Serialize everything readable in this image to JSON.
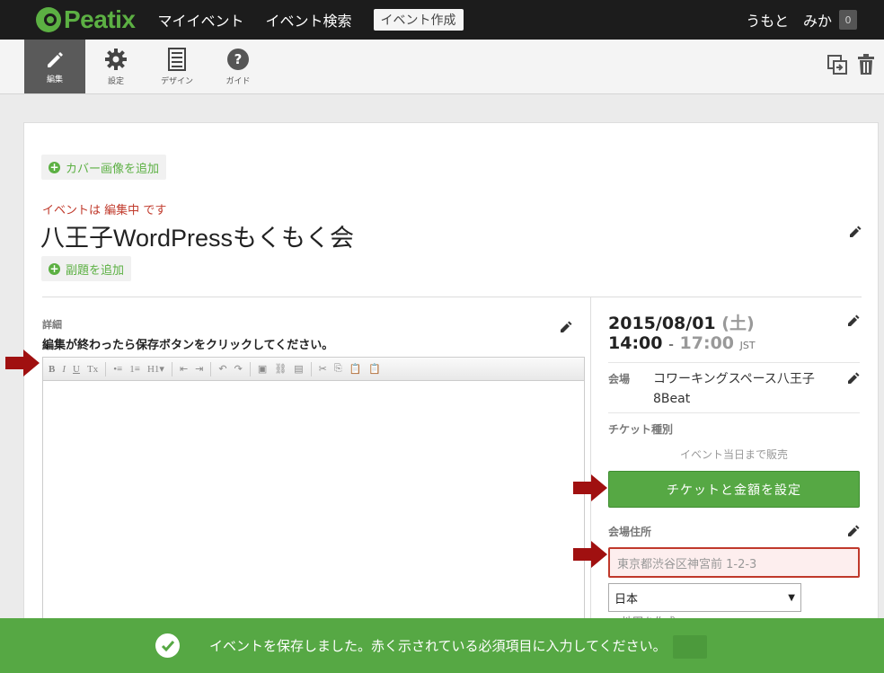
{
  "topnav": {
    "logo": "Peatix",
    "links": [
      "マイイベント",
      "イベント検索"
    ],
    "create_button": "イベント作成",
    "user_first": "うもと",
    "user_second": "みか",
    "notification_count": "0"
  },
  "toolbar": {
    "tabs": [
      {
        "label": "編集",
        "icon": "pencil-icon"
      },
      {
        "label": "設定",
        "icon": "gear-icon"
      },
      {
        "label": "デザイン",
        "icon": "document-icon"
      },
      {
        "label": "ガイド",
        "icon": "help-icon"
      }
    ],
    "right_icons": [
      "copy-icon",
      "trash-icon"
    ]
  },
  "event": {
    "add_cover": "カバー画像を追加",
    "status_prefix": "イベントは",
    "status_value": "編集中",
    "status_suffix": "です",
    "title": "八王子WordPressもくもく会",
    "add_subtitle": "副題を追加",
    "details_label": "詳細",
    "details_instruction": "編集が終わったら保存ボタンをクリックしてください。",
    "editor_toolbar": [
      "B",
      "I",
      "U",
      "Tx",
      "|",
      "•≡",
      "1≡",
      "H1▾",
      "|",
      "⇤",
      "⇥",
      "|",
      "↶",
      "↷",
      "|",
      "▣",
      "⛓",
      "▤",
      "|",
      "✂",
      "⎘",
      "📋",
      "📋"
    ]
  },
  "sidebar": {
    "date": "2015/08/01",
    "day": "(土)",
    "start_time": "14:00",
    "time_sep": "-",
    "end_time": "17:00",
    "timezone": "JST",
    "venue_label": "会場",
    "venue_name_line1": "コワーキングスペース八王子",
    "venue_name_line2": "8Beat",
    "ticket_label": "チケット種別",
    "ticket_note": "イベント当日まで販売",
    "ticket_button": "チケットと金額を設定",
    "address_label": "会場住所",
    "address_placeholder": "東京都渋谷区神宮前 1-2-3",
    "country": "日本",
    "partial": "□ 地図を作成"
  },
  "toast": {
    "message": "イベントを保存しました。赤く示されている必須項目に入力してください。"
  },
  "colors": {
    "brand_green": "#5cb043",
    "button_green": "#56a844",
    "error_red": "#c0392b",
    "arrow_red": "#a01010"
  }
}
